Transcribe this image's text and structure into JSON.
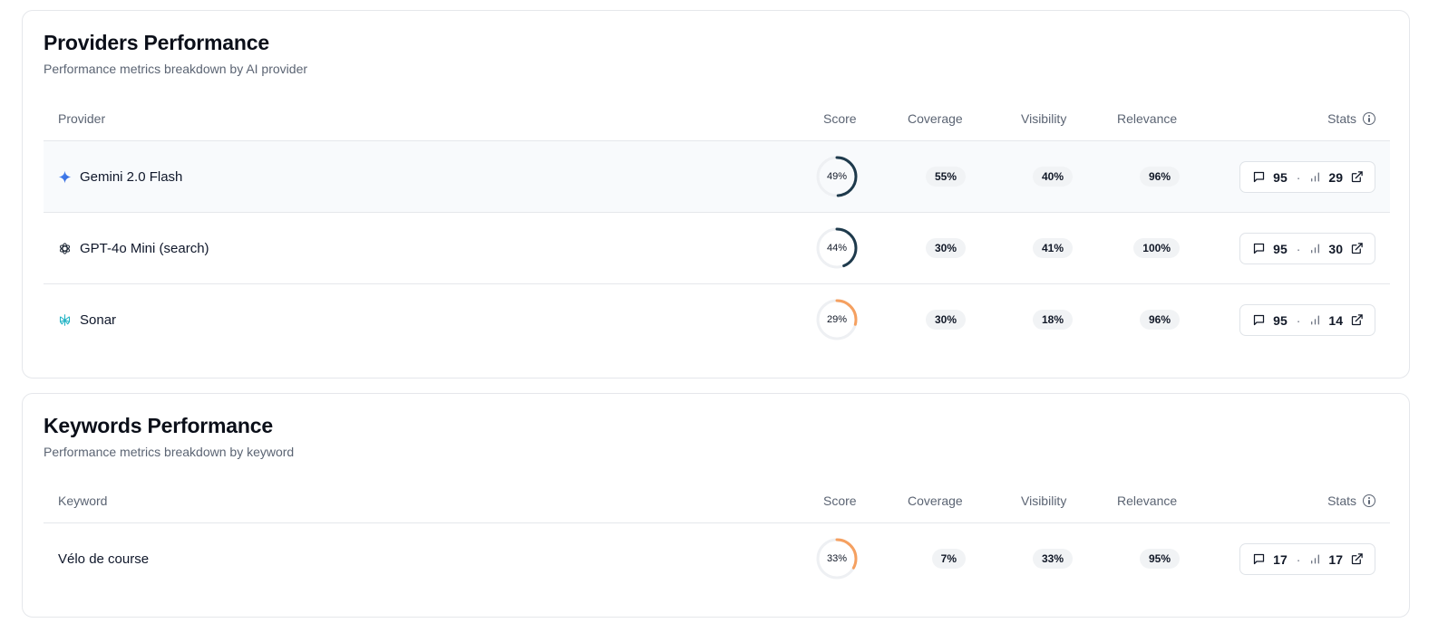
{
  "providers_card": {
    "title": "Providers Performance",
    "subtitle": "Performance metrics breakdown by AI provider",
    "headers": {
      "name": "Provider",
      "score": "Score",
      "coverage": "Coverage",
      "visibility": "Visibility",
      "relevance": "Relevance",
      "stats": "Stats"
    },
    "rows": [
      {
        "name": "Gemini 2.0 Flash",
        "icon": "gemini-sparkle-icon",
        "score": 49,
        "score_label": "49%",
        "coverage": "55%",
        "visibility": "40%",
        "relevance": "96%",
        "stats_messages": "95",
        "stats_mentions": "29"
      },
      {
        "name": "GPT-4o Mini (search)",
        "icon": "openai-logo-icon",
        "score": 44,
        "score_label": "44%",
        "coverage": "30%",
        "visibility": "41%",
        "relevance": "100%",
        "stats_messages": "95",
        "stats_mentions": "30"
      },
      {
        "name": "Sonar",
        "icon": "perplexity-logo-icon",
        "score": 29,
        "score_label": "29%",
        "coverage": "30%",
        "visibility": "18%",
        "relevance": "96%",
        "stats_messages": "95",
        "stats_mentions": "14"
      }
    ]
  },
  "keywords_card": {
    "title": "Keywords Performance",
    "subtitle": "Performance metrics breakdown by keyword",
    "headers": {
      "name": "Keyword",
      "score": "Score",
      "coverage": "Coverage",
      "visibility": "Visibility",
      "relevance": "Relevance",
      "stats": "Stats"
    },
    "rows": [
      {
        "name": "Vélo de course",
        "score": 33,
        "score_label": "33%",
        "coverage": "7%",
        "visibility": "33%",
        "relevance": "95%",
        "stats_messages": "17",
        "stats_mentions": "17"
      }
    ]
  },
  "colors": {
    "score_high": "#1e3a4c",
    "score_low": "#f5a060",
    "track": "#eef0f3"
  }
}
